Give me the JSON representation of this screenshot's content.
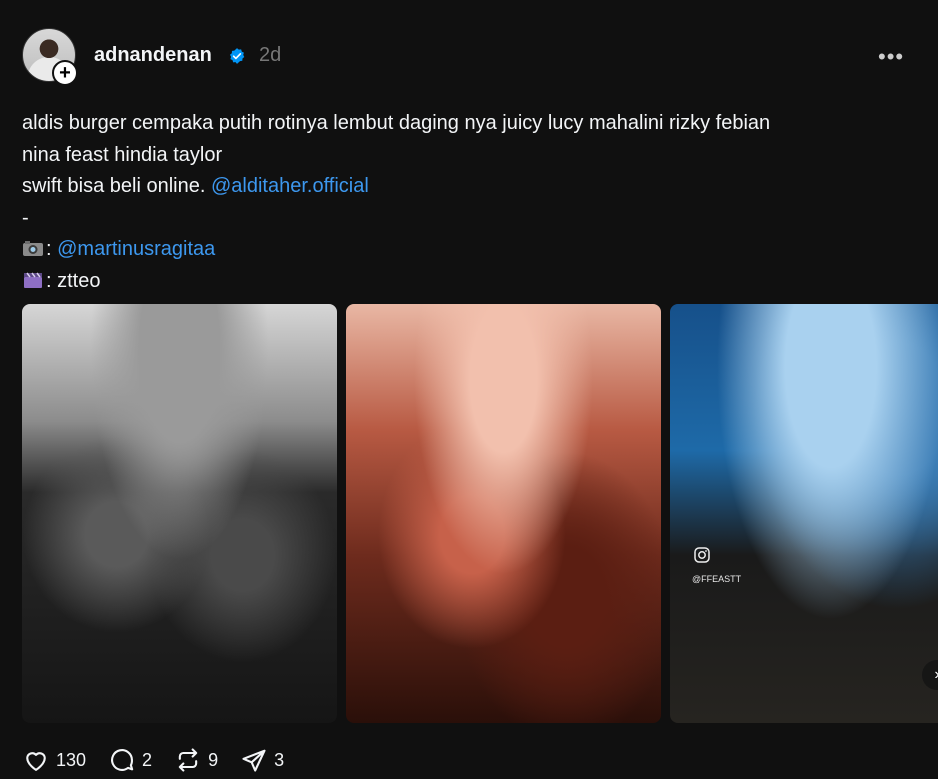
{
  "post": {
    "username": "adnandenan",
    "time": "2d",
    "more_label": "•••",
    "follow_label": "+",
    "caption": {
      "line1": "aldis burger cempaka putih rotinya lembut daging nya juicy lucy mahalini rizky febian",
      "line2": "nina feast hindia taylor",
      "line3_text": "swift bisa beli online. ",
      "line3_mention": "@alditaher.official",
      "line4": "-",
      "line5_prefix": ": ",
      "line5_mention": "@martinusragitaa",
      "line6_text": ": ztteo"
    },
    "media": {
      "watermark": "@FFEASTT"
    },
    "actions": {
      "likes": "130",
      "replies": "2",
      "reposts": "9",
      "shares": "3"
    }
  },
  "icons": [
    "verified-badge-icon",
    "more-icon",
    "camera-emoji-icon",
    "clapper-emoji-icon",
    "instagram-icon",
    "chevron-right-icon",
    "heart-icon",
    "reply-icon",
    "repost-icon",
    "share-icon"
  ],
  "colors": {
    "background": "#101010",
    "text": "#f3f5f7",
    "mention": "#3d98ef",
    "muted": "#777777",
    "verified": "#0095f6"
  }
}
